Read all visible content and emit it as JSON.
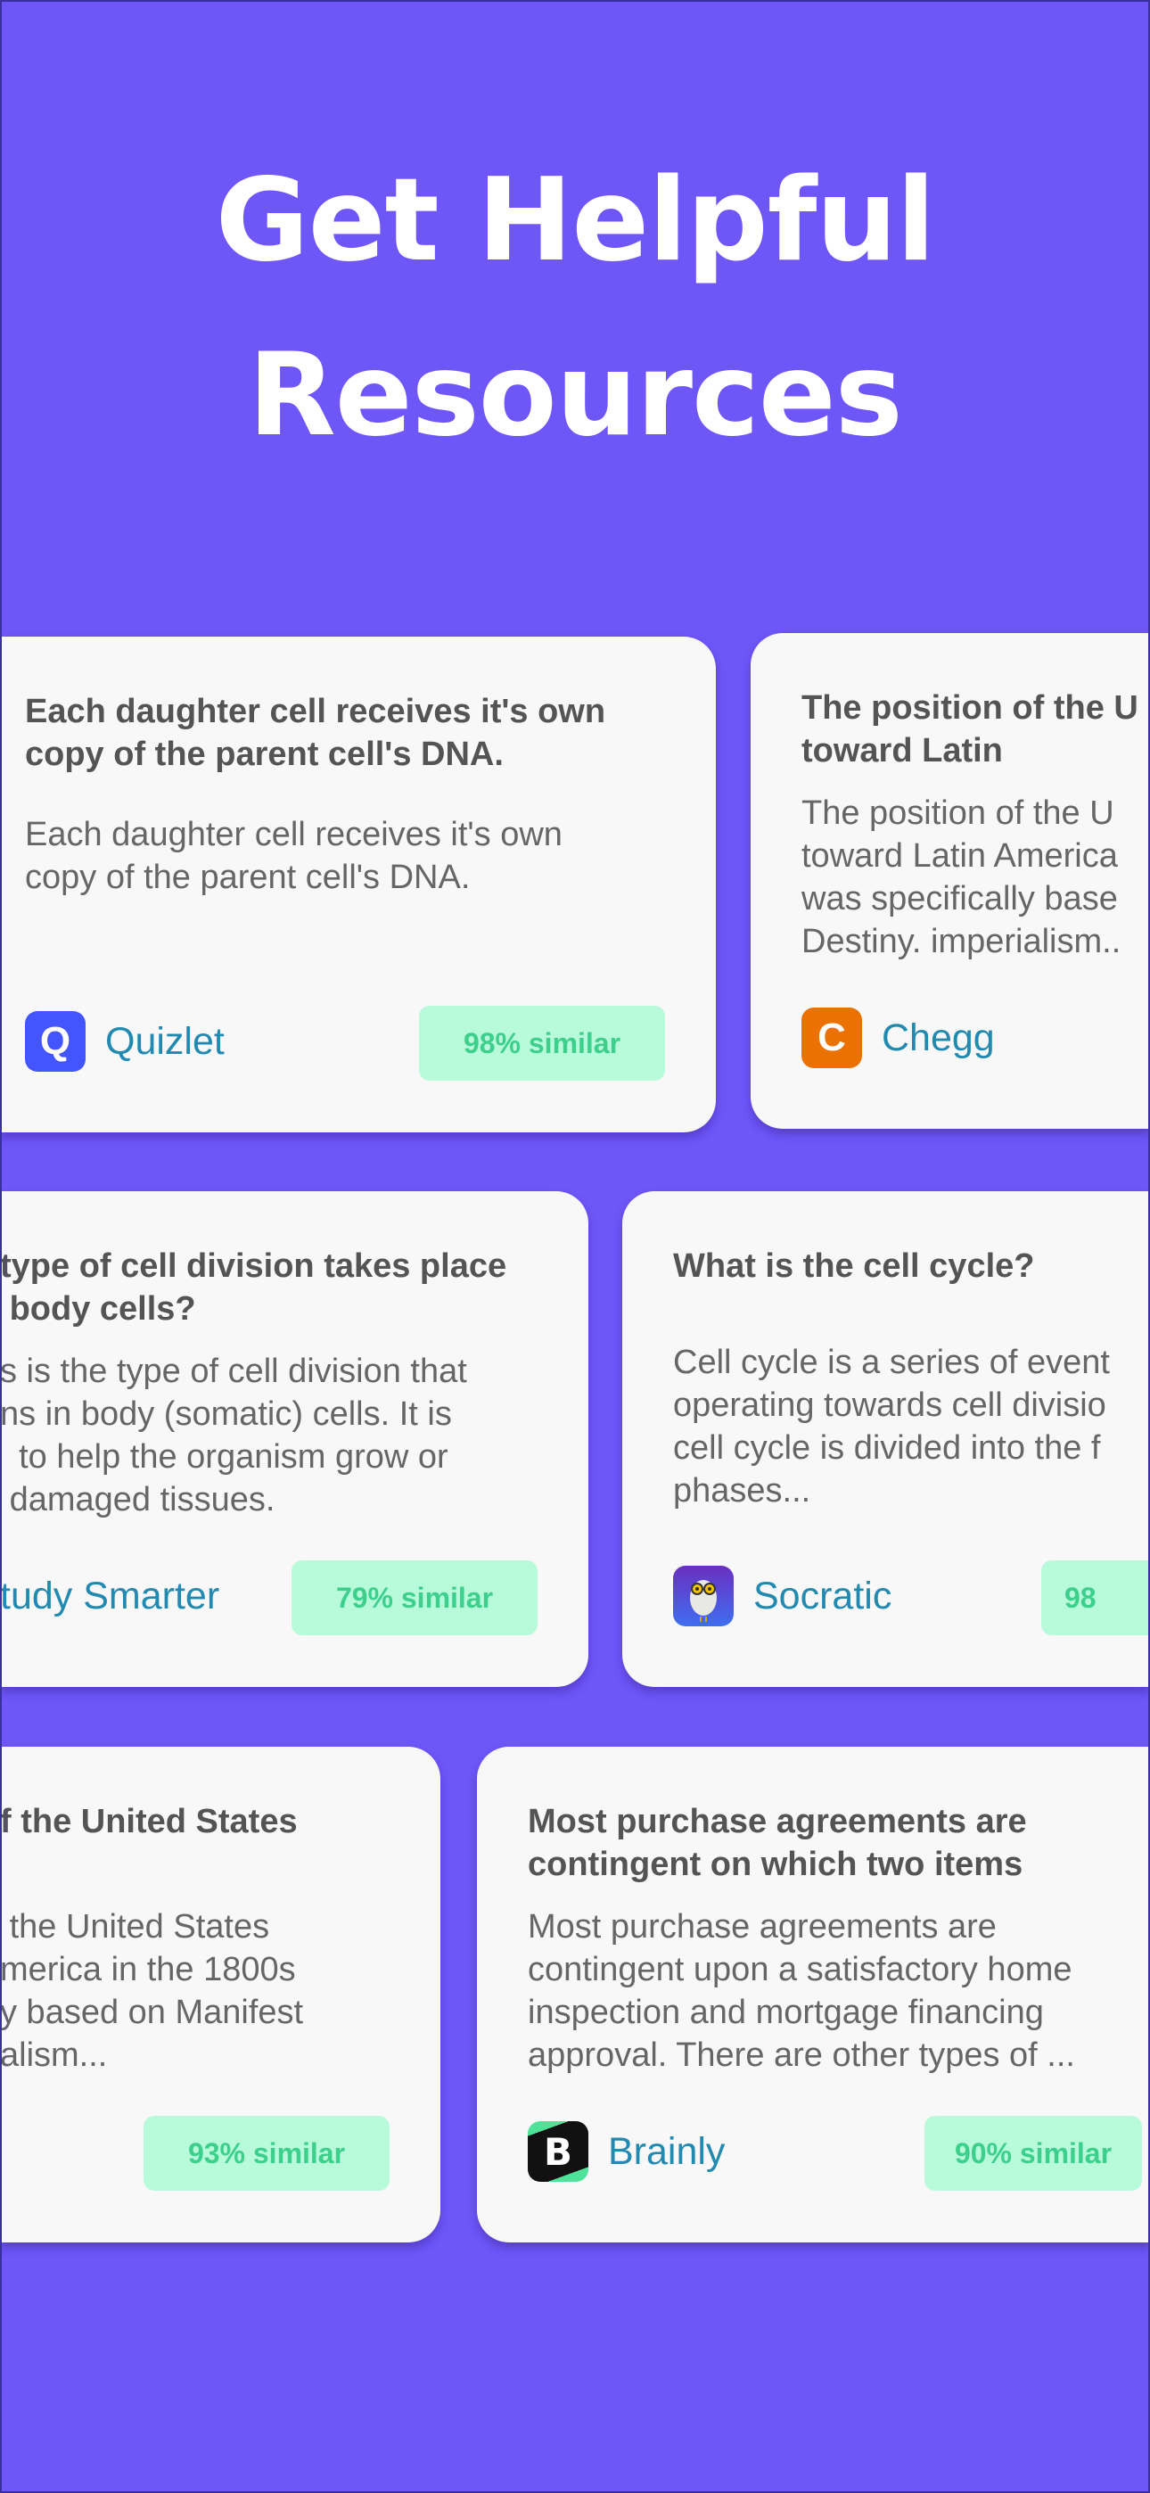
{
  "header": {
    "title_line1": "Get Helpful",
    "title_line2": "Resources"
  },
  "colors": {
    "background": "#6e56f9",
    "card": "#f8f8f8",
    "source_text": "#2289b0",
    "badge_bg": "#b8fbda",
    "badge_text": "#3dcf8c"
  },
  "cards": [
    {
      "title": [
        "Each daughter cell receives it's own",
        "copy of the parent cell's DNA."
      ],
      "body": [
        "Each daughter cell receives it's own",
        "copy of the parent cell's DNA."
      ],
      "source": "Quizlet",
      "logo_icon": "quizlet-q-icon",
      "logo_letter": "Q",
      "similarity": "98% similar"
    },
    {
      "title": [
        "The position of the U",
        "toward Latin"
      ],
      "body": [
        "The position of the U",
        "toward Latin America",
        "was specifically base",
        "Destiny. imperialism.."
      ],
      "source": "Chegg",
      "logo_icon": "chegg-c-icon",
      "logo_letter": "C",
      "similarity": ""
    },
    {
      "title": [
        "type of cell division takes place",
        " body cells?"
      ],
      "body": [
        "s is the type of cell division that",
        "ns in body (somatic) cells. It is",
        "  to help the organism grow or",
        " damaged tissues."
      ],
      "source": "tudy Smarter",
      "logo_icon": "",
      "logo_letter": "",
      "similarity": "79% similar"
    },
    {
      "title": [
        "What is the cell cycle?"
      ],
      "body": [
        "Cell cycle is a series of event",
        "operating towards cell divisio",
        "cell cycle is divided into the f",
        "phases..."
      ],
      "source": "Socratic",
      "logo_icon": "socratic-owl-icon",
      "logo_letter": "",
      "similarity": "98"
    },
    {
      "title": [
        "f the United States"
      ],
      "body": [
        " the United States",
        "merica in the 1800s",
        "y based on Manifest",
        "alism..."
      ],
      "source": "",
      "logo_icon": "",
      "logo_letter": "",
      "similarity": "93% similar"
    },
    {
      "title": [
        "Most purchase agreements are",
        "contingent on which two items"
      ],
      "body": [
        "Most purchase agreements are",
        "contingent upon a satisfactory home",
        "inspection and mortgage financing",
        "approval. There are other types of ..."
      ],
      "source": "Brainly",
      "logo_icon": "brainly-b-icon",
      "logo_letter": "B",
      "similarity": "90% similar"
    }
  ]
}
